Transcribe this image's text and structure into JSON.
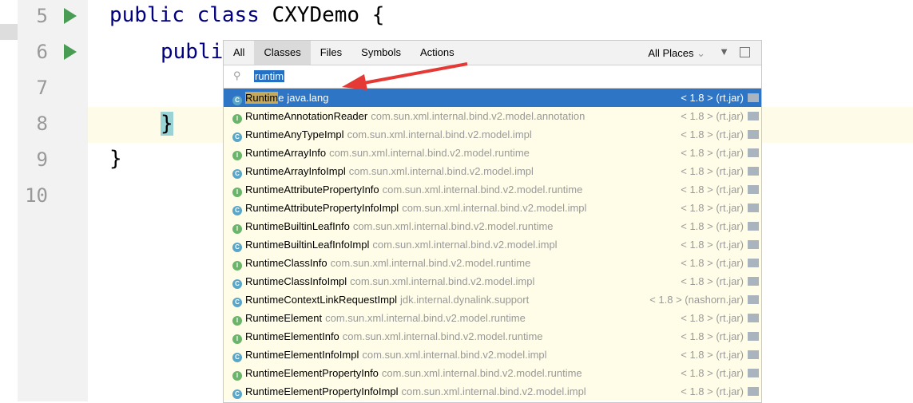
{
  "editor": {
    "lines": [
      {
        "n": "5",
        "run": true
      },
      {
        "n": "6",
        "run": true
      },
      {
        "n": "7"
      },
      {
        "n": "8"
      },
      {
        "n": "9"
      },
      {
        "n": "10"
      }
    ],
    "code": {
      "l5_kw": "public class ",
      "l5_rest": "CXYDemo {",
      "l6_kw": "publi",
      "l8": "}",
      "l9": "}"
    }
  },
  "popup": {
    "tabs": [
      "All",
      "Classes",
      "Files",
      "Symbols",
      "Actions"
    ],
    "active_tab": "Classes",
    "places": "All Places",
    "query": "runtim",
    "selected_match": "Runtim",
    "selected_rest": "e",
    "selected_pkg": "java.lang",
    "selected_ver": "< 1.8 > (rt.jar)",
    "results": [
      {
        "icon": "i",
        "name": "RuntimeAnnotationReader",
        "pkg": "com.sun.xml.internal.bind.v2.model.annotation",
        "ver": "< 1.8 > (rt.jar)"
      },
      {
        "icon": "c",
        "name": "RuntimeAnyTypeImpl",
        "pkg": "com.sun.xml.internal.bind.v2.model.impl",
        "ver": "< 1.8 > (rt.jar)"
      },
      {
        "icon": "i",
        "name": "RuntimeArrayInfo",
        "pkg": "com.sun.xml.internal.bind.v2.model.runtime",
        "ver": "< 1.8 > (rt.jar)"
      },
      {
        "icon": "c",
        "name": "RuntimeArrayInfoImpl",
        "pkg": "com.sun.xml.internal.bind.v2.model.impl",
        "ver": "< 1.8 > (rt.jar)"
      },
      {
        "icon": "i",
        "name": "RuntimeAttributePropertyInfo",
        "pkg": "com.sun.xml.internal.bind.v2.model.runtime",
        "ver": "< 1.8 > (rt.jar)"
      },
      {
        "icon": "c",
        "name": "RuntimeAttributePropertyInfoImpl",
        "pkg": "com.sun.xml.internal.bind.v2.model.impl",
        "ver": "< 1.8 > (rt.jar)"
      },
      {
        "icon": "i",
        "name": "RuntimeBuiltinLeafInfo",
        "pkg": "com.sun.xml.internal.bind.v2.model.runtime",
        "ver": "< 1.8 > (rt.jar)"
      },
      {
        "icon": "c",
        "name": "RuntimeBuiltinLeafInfoImpl",
        "pkg": "com.sun.xml.internal.bind.v2.model.impl",
        "ver": "< 1.8 > (rt.jar)"
      },
      {
        "icon": "i",
        "name": "RuntimeClassInfo",
        "pkg": "com.sun.xml.internal.bind.v2.model.runtime",
        "ver": "< 1.8 > (rt.jar)"
      },
      {
        "icon": "c",
        "name": "RuntimeClassInfoImpl",
        "pkg": "com.sun.xml.internal.bind.v2.model.impl",
        "ver": "< 1.8 > (rt.jar)"
      },
      {
        "icon": "c",
        "name": "RuntimeContextLinkRequestImpl",
        "pkg": "jdk.internal.dynalink.support",
        "ver": "< 1.8 > (nashorn.jar)"
      },
      {
        "icon": "i",
        "name": "RuntimeElement",
        "pkg": "com.sun.xml.internal.bind.v2.model.runtime",
        "ver": "< 1.8 > (rt.jar)"
      },
      {
        "icon": "i",
        "name": "RuntimeElementInfo",
        "pkg": "com.sun.xml.internal.bind.v2.model.runtime",
        "ver": "< 1.8 > (rt.jar)"
      },
      {
        "icon": "c",
        "name": "RuntimeElementInfoImpl",
        "pkg": "com.sun.xml.internal.bind.v2.model.impl",
        "ver": "< 1.8 > (rt.jar)"
      },
      {
        "icon": "i",
        "name": "RuntimeElementPropertyInfo",
        "pkg": "com.sun.xml.internal.bind.v2.model.runtime",
        "ver": "< 1.8 > (rt.jar)"
      },
      {
        "icon": "c",
        "name": "RuntimeElementPropertyInfoImpl",
        "pkg": "com.sun.xml.internal.bind.v2.model.impl",
        "ver": "< 1.8 > (rt.jar)"
      }
    ]
  },
  "colors": {
    "selection": "#2f75c5",
    "arrow": "#e53935",
    "run": "#499c54"
  }
}
